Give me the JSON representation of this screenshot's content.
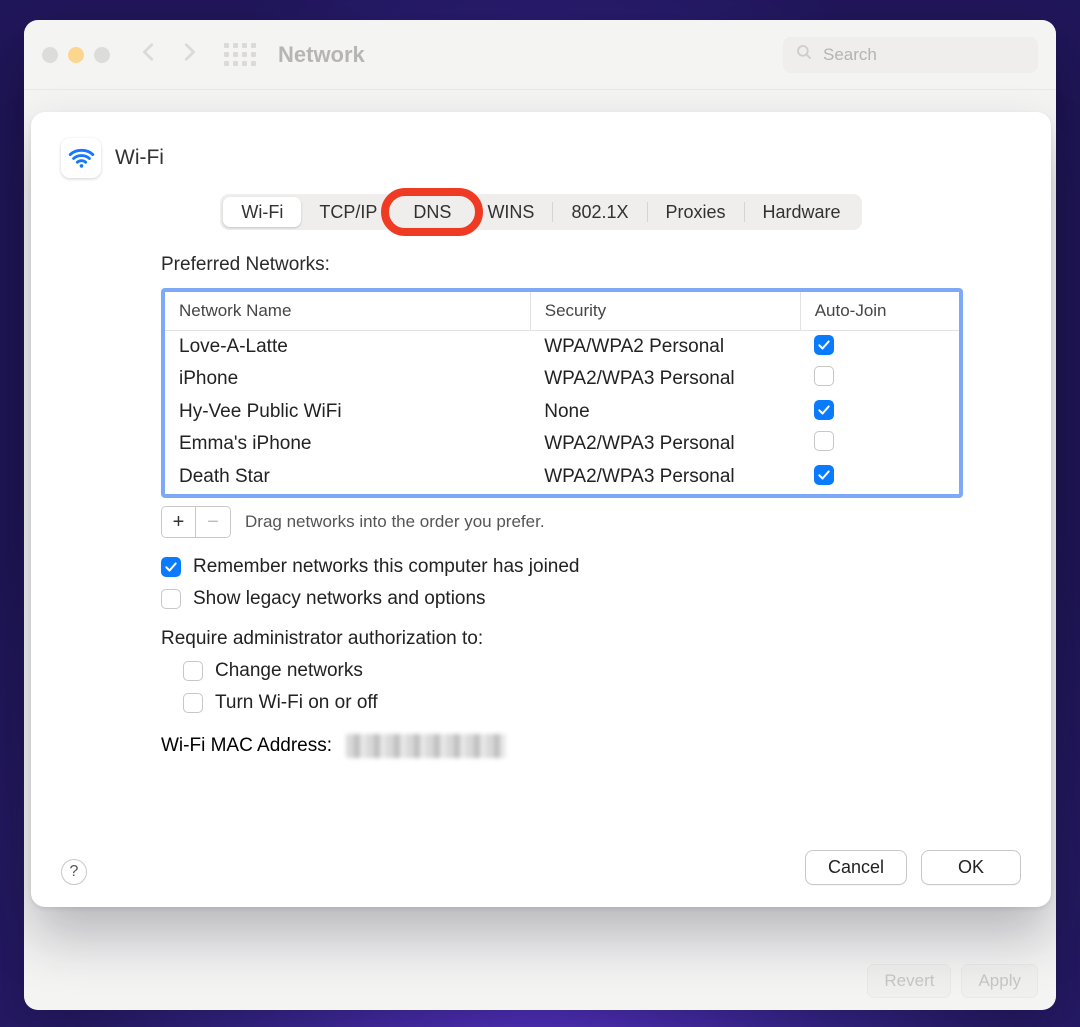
{
  "parent": {
    "title": "Network",
    "search_placeholder": "Search",
    "buttons": {
      "revert": "Revert",
      "apply": "Apply"
    }
  },
  "sheet": {
    "title": "Wi-Fi",
    "tabs": {
      "wifi": "Wi-Fi",
      "tcpip": "TCP/IP",
      "dns": "DNS",
      "wins": "WINS",
      "8021x": "802.1X",
      "proxies": "Proxies",
      "hardware": "Hardware",
      "active": "wifi",
      "highlighted": "dns"
    },
    "preferred_label": "Preferred Networks:",
    "columns": {
      "name": "Network Name",
      "security": "Security",
      "autojoin": "Auto-Join"
    },
    "networks": [
      {
        "name": "Love-A-Latte",
        "security": "WPA/WPA2 Personal",
        "autojoin": true
      },
      {
        "name": "iPhone",
        "security": "WPA2/WPA3 Personal",
        "autojoin": false
      },
      {
        "name": "Hy-Vee Public WiFi",
        "security": "None",
        "autojoin": true
      },
      {
        "name": "Emma's iPhone",
        "security": "WPA2/WPA3 Personal",
        "autojoin": false
      },
      {
        "name": "Death Star",
        "security": "WPA2/WPA3 Personal",
        "autojoin": true
      }
    ],
    "drag_hint": "Drag networks into the order you prefer.",
    "options": {
      "remember": {
        "label": "Remember networks this computer has joined",
        "checked": true
      },
      "show_legacy": {
        "label": "Show legacy networks and options",
        "checked": false
      },
      "require_admin_label": "Require administrator authorization to:",
      "change_networks": {
        "label": "Change networks",
        "checked": false
      },
      "turn_wifi": {
        "label": "Turn Wi-Fi on or off",
        "checked": false
      }
    },
    "mac_label": "Wi-Fi MAC Address:",
    "buttons": {
      "cancel": "Cancel",
      "ok": "OK",
      "help": "?"
    }
  }
}
